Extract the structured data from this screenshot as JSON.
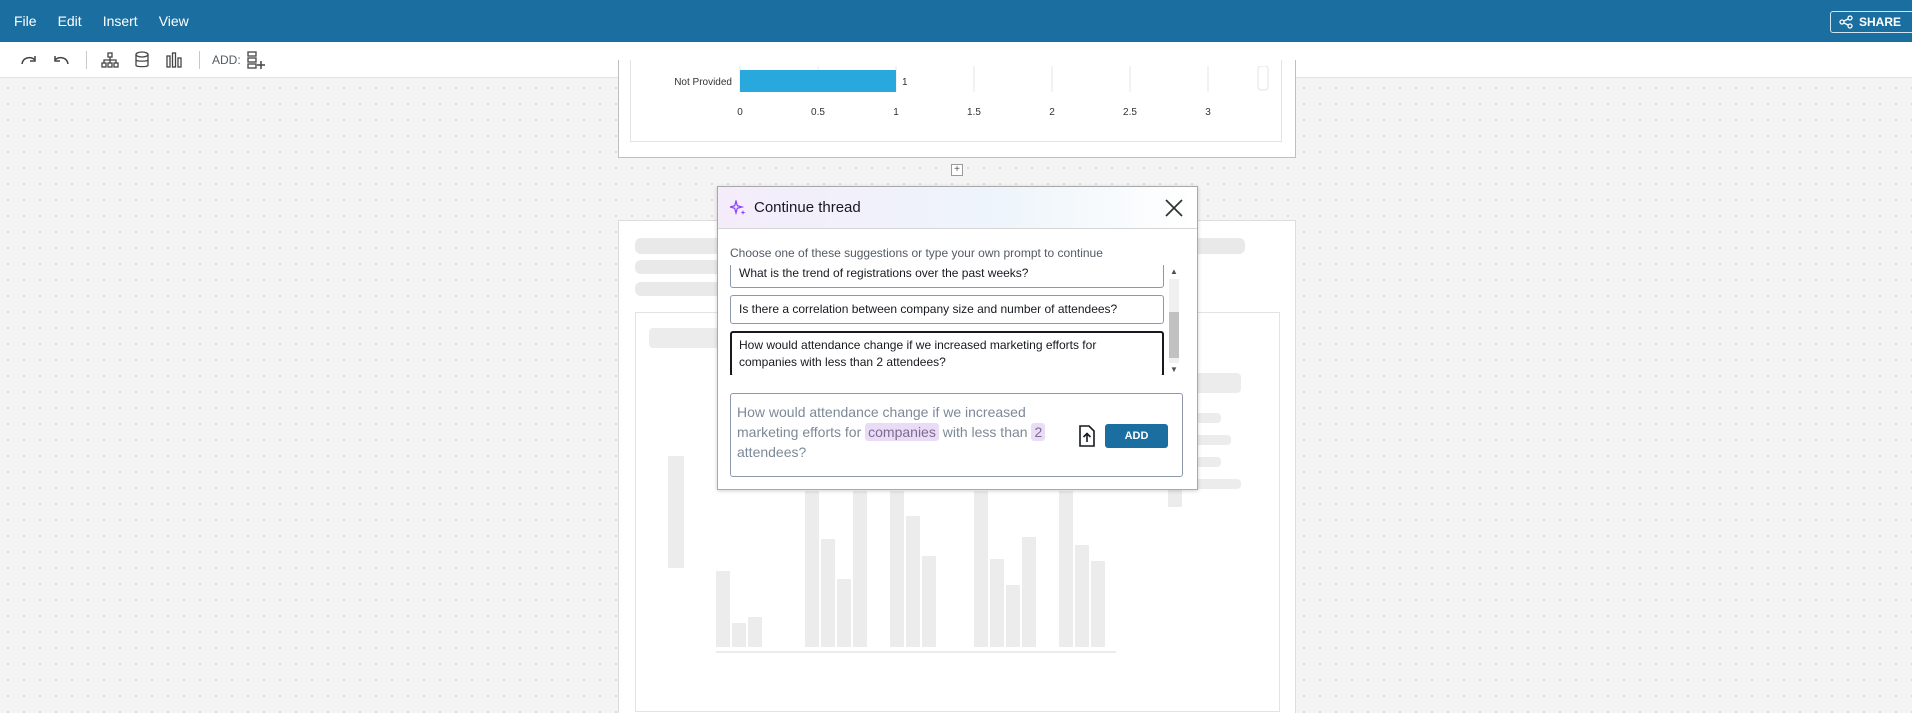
{
  "menubar": {
    "items": [
      "File",
      "Edit",
      "Insert",
      "View"
    ],
    "share_label": "SHARE"
  },
  "toolbar": {
    "icons": [
      "redo-icon",
      "undo-icon",
      "hierarchy-icon",
      "dataset-icon",
      "visual-icon"
    ],
    "add_label": "ADD:"
  },
  "chart_data": {
    "type": "bar",
    "orientation": "horizontal",
    "categories": [
      "Not Provided"
    ],
    "values": [
      1
    ],
    "data_labels": [
      "1"
    ],
    "xlim": [
      0,
      3
    ],
    "x_ticks": [
      "0",
      "0.5",
      "1",
      "1.5",
      "2",
      "2.5",
      "3"
    ],
    "grid": true,
    "bar_color": "#29a8de"
  },
  "dialog": {
    "title": "Continue thread",
    "subtitle": "Choose one of these suggestions or type your own prompt to continue",
    "suggestions": [
      "What is the trend of registrations over the past weeks?",
      "Is there a correlation between company size and number of attendees?",
      "How would attendance change if we increased marketing efforts for companies with less than 2 attendees?"
    ],
    "selected_index": 2,
    "prompt": {
      "part1": "How would attendance change if we increased marketing efforts for ",
      "chip1": "companies",
      "part2": " with less than ",
      "chip2": "2",
      "part3": " attendees?"
    },
    "add_label": "ADD"
  },
  "colors": {
    "brand": "#1b6fa0",
    "accent_purple": "#8a3ffc",
    "bar": "#29a8de"
  }
}
